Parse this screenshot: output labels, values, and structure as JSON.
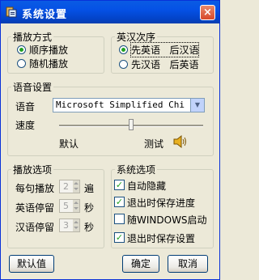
{
  "window": {
    "title": "系统设置",
    "close_glyph": "×"
  },
  "play_mode": {
    "legend": "播放方式",
    "options": [
      "顺序播放",
      "随机播放"
    ],
    "selected": 0
  },
  "order": {
    "legend": "英汉次序",
    "options": [
      [
        "先英语",
        "后汉语"
      ],
      [
        "先汉语",
        "后英语"
      ]
    ],
    "selected": 0
  },
  "voice": {
    "legend": "语音设置",
    "voice_label": "语音",
    "voice_value": "Microsoft Simplified Chinese",
    "speed_label": "速度",
    "speed_value": 0.5,
    "default_label": "默认",
    "test_label": "测试",
    "speaker_icon": "speaker-icon"
  },
  "play_options": {
    "legend": "播放选项",
    "rows": [
      {
        "label": "每句播放",
        "value": "2",
        "unit": "遍"
      },
      {
        "label": "英语停留",
        "value": "5",
        "unit": "秒"
      },
      {
        "label": "汉语停留",
        "value": "3",
        "unit": "秒"
      }
    ]
  },
  "system_options": {
    "legend": "系统选项",
    "items": [
      {
        "label": "自动隐藏",
        "checked": true
      },
      {
        "label": "退出时保存进度",
        "checked": true
      },
      {
        "label": "随WINDOWS启动",
        "checked": false
      },
      {
        "label": "退出时保存设置",
        "checked": true
      }
    ]
  },
  "buttons": {
    "default": "默认值",
    "ok": "确定",
    "cancel": "取消"
  }
}
